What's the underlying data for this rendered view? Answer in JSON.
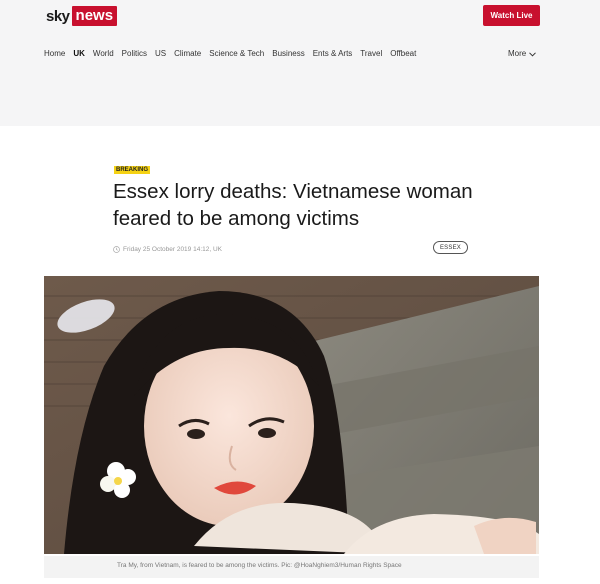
{
  "header": {
    "logo_sky": "sky",
    "logo_news": "news",
    "watch_live_label": "Watch Live",
    "nav": [
      "Home",
      "UK",
      "World",
      "Politics",
      "US",
      "Climate",
      "Science & Tech",
      "Business",
      "Ents & Arts",
      "Travel",
      "Offbeat"
    ],
    "active_nav": "UK",
    "more_label": "More"
  },
  "article": {
    "badge": "BREAKING",
    "headline": "Essex lorry deaths: Vietnamese woman feared to be among victims",
    "timestamp": "Friday 25 October 2019 14:12, UK",
    "tag": "ESSEX",
    "image_alt": "Portrait photo of a young woman with a white flower in her hair",
    "caption": "Tra My, from Vietnam, is feared to be among the victims. Pic: @HoaNghiem3/Human Rights Space"
  },
  "colors": {
    "brand_red": "#c8102e",
    "breaking_yellow": "#f5d214",
    "header_bg": "#f5f5f6"
  }
}
